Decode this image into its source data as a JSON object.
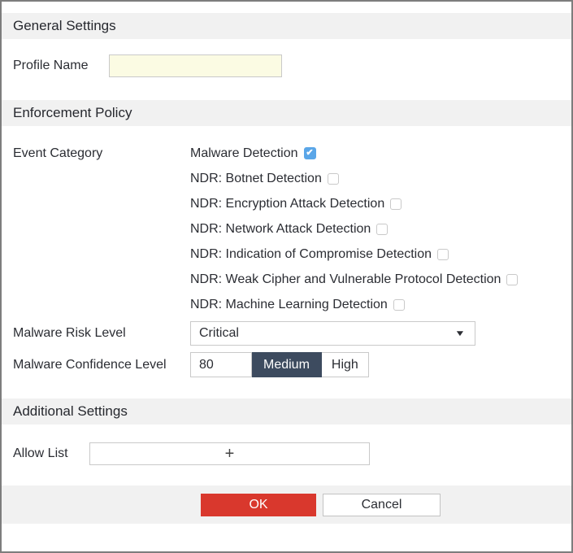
{
  "dialog": {
    "sections": {
      "general": {
        "title": "General Settings"
      },
      "enforcement": {
        "title": "Enforcement Policy"
      },
      "additional": {
        "title": "Additional Settings"
      }
    },
    "fields": {
      "profile_name": {
        "label": "Profile Name",
        "value": "",
        "placeholder": ""
      },
      "event_category": {
        "label": "Event Category",
        "options": [
          {
            "label": "Malware Detection",
            "checked": true
          },
          {
            "label": "NDR: Botnet Detection",
            "checked": false
          },
          {
            "label": "NDR: Encryption Attack Detection",
            "checked": false
          },
          {
            "label": "NDR: Network Attack Detection",
            "checked": false
          },
          {
            "label": "NDR: Indication of Compromise Detection",
            "checked": false
          },
          {
            "label": "NDR: Weak Cipher and Vulnerable Protocol Detection",
            "checked": false
          },
          {
            "label": "NDR: Machine Learning Detection",
            "checked": false
          }
        ]
      },
      "malware_risk_level": {
        "label": "Malware Risk Level",
        "selected": "Critical"
      },
      "malware_confidence_level": {
        "label": "Malware Confidence Level",
        "value": "80",
        "segments": [
          {
            "label": "Medium",
            "selected": true
          },
          {
            "label": "High",
            "selected": false
          }
        ]
      },
      "allow_list": {
        "label": "Allow List"
      }
    },
    "buttons": {
      "ok": "OK",
      "cancel": "Cancel"
    },
    "icons": {
      "check": "✔",
      "dropdown_arrow": "▼",
      "add": "+"
    },
    "colors": {
      "accent_red": "#d9382d",
      "checkbox_checked_blue": "#5aa6e8",
      "segment_selected_navy": "#3d4b5f",
      "section_header_gray": "#f1f1f1",
      "input_highlight_yellow": "#fbfbe3"
    }
  }
}
